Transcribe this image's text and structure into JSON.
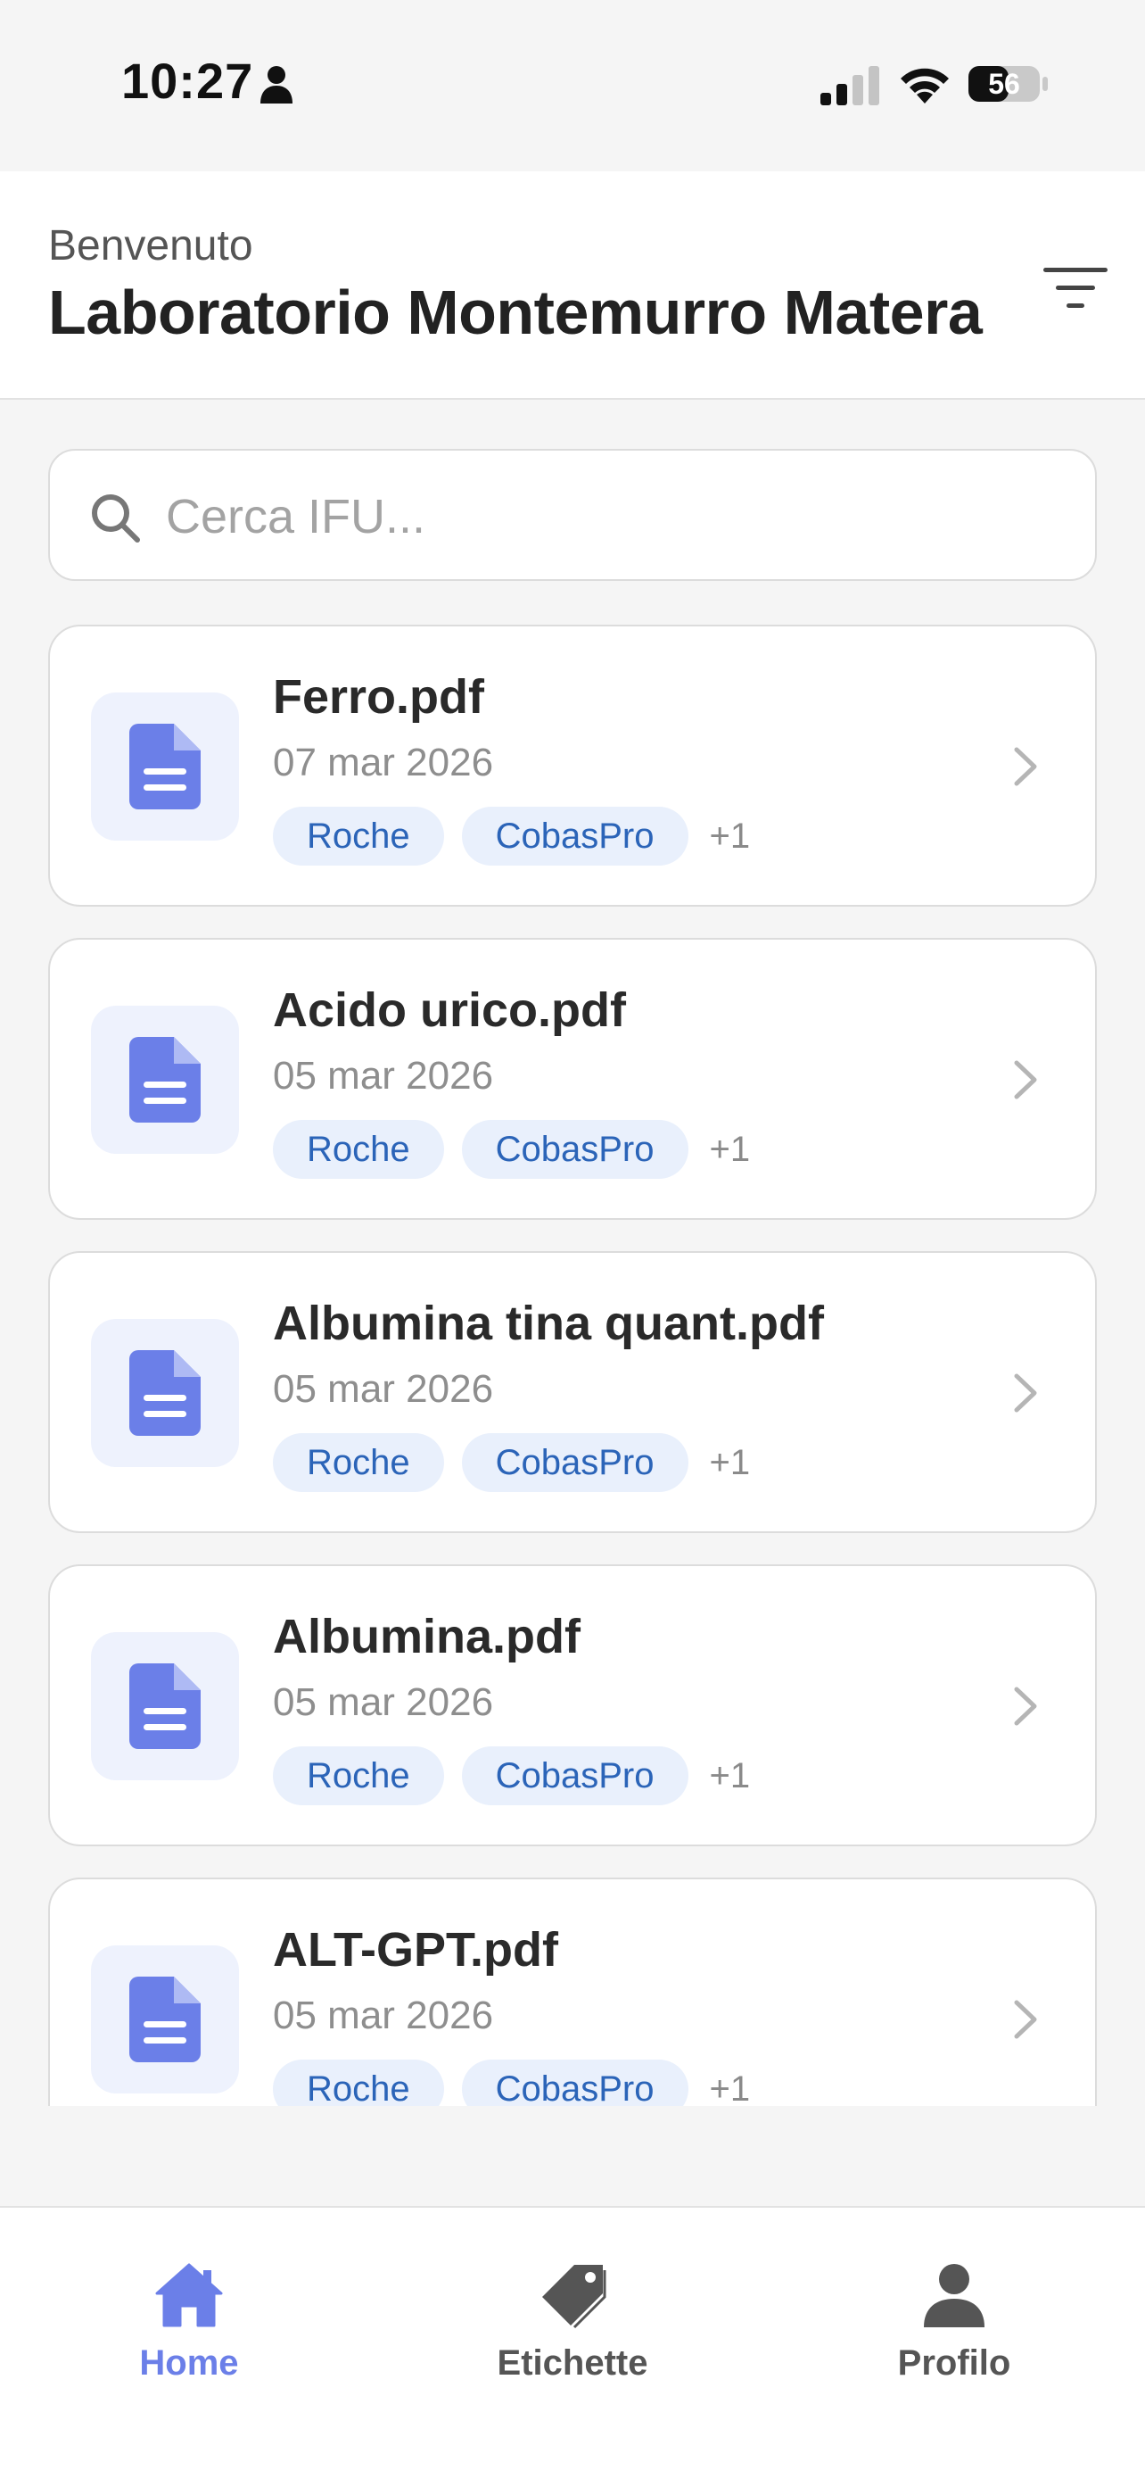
{
  "status_bar": {
    "time": "10:27",
    "battery": "56",
    "icons": [
      "person-icon",
      "signal-icon",
      "wifi-icon",
      "battery-icon"
    ]
  },
  "header": {
    "welcome": "Benvenuto",
    "title": "Laboratorio Montemurro Matera",
    "filter_icon": "filter-icon"
  },
  "search": {
    "placeholder": "Cerca IFU...",
    "value": ""
  },
  "documents": [
    {
      "name": "Ferro.pdf",
      "date": "07 mar 2026",
      "tags": [
        "Roche",
        "CobasPro"
      ],
      "more": "+1"
    },
    {
      "name": "Acido urico.pdf",
      "date": "05 mar 2026",
      "tags": [
        "Roche",
        "CobasPro"
      ],
      "more": "+1"
    },
    {
      "name": "Albumina tina quant.pdf",
      "date": "05 mar 2026",
      "tags": [
        "Roche",
        "CobasPro"
      ],
      "more": "+1"
    },
    {
      "name": "Albumina.pdf",
      "date": "05 mar 2026",
      "tags": [
        "Roche",
        "CobasPro"
      ],
      "more": "+1"
    },
    {
      "name": "ALT-GPT.pdf",
      "date": "05 mar 2026",
      "tags": [
        "Roche",
        "CobasPro"
      ],
      "more": "+1"
    }
  ],
  "tabs": [
    {
      "label": "Home",
      "icon": "home-icon",
      "active": true
    },
    {
      "label": "Etichette",
      "icon": "tag-icon",
      "active": false
    },
    {
      "label": "Profilo",
      "icon": "person-icon",
      "active": false
    }
  ],
  "colors": {
    "accent": "#6b7fe8",
    "tag_bg": "#e9f0fc",
    "tag_text": "#2b64b8",
    "inactive_tab": "#555555"
  }
}
